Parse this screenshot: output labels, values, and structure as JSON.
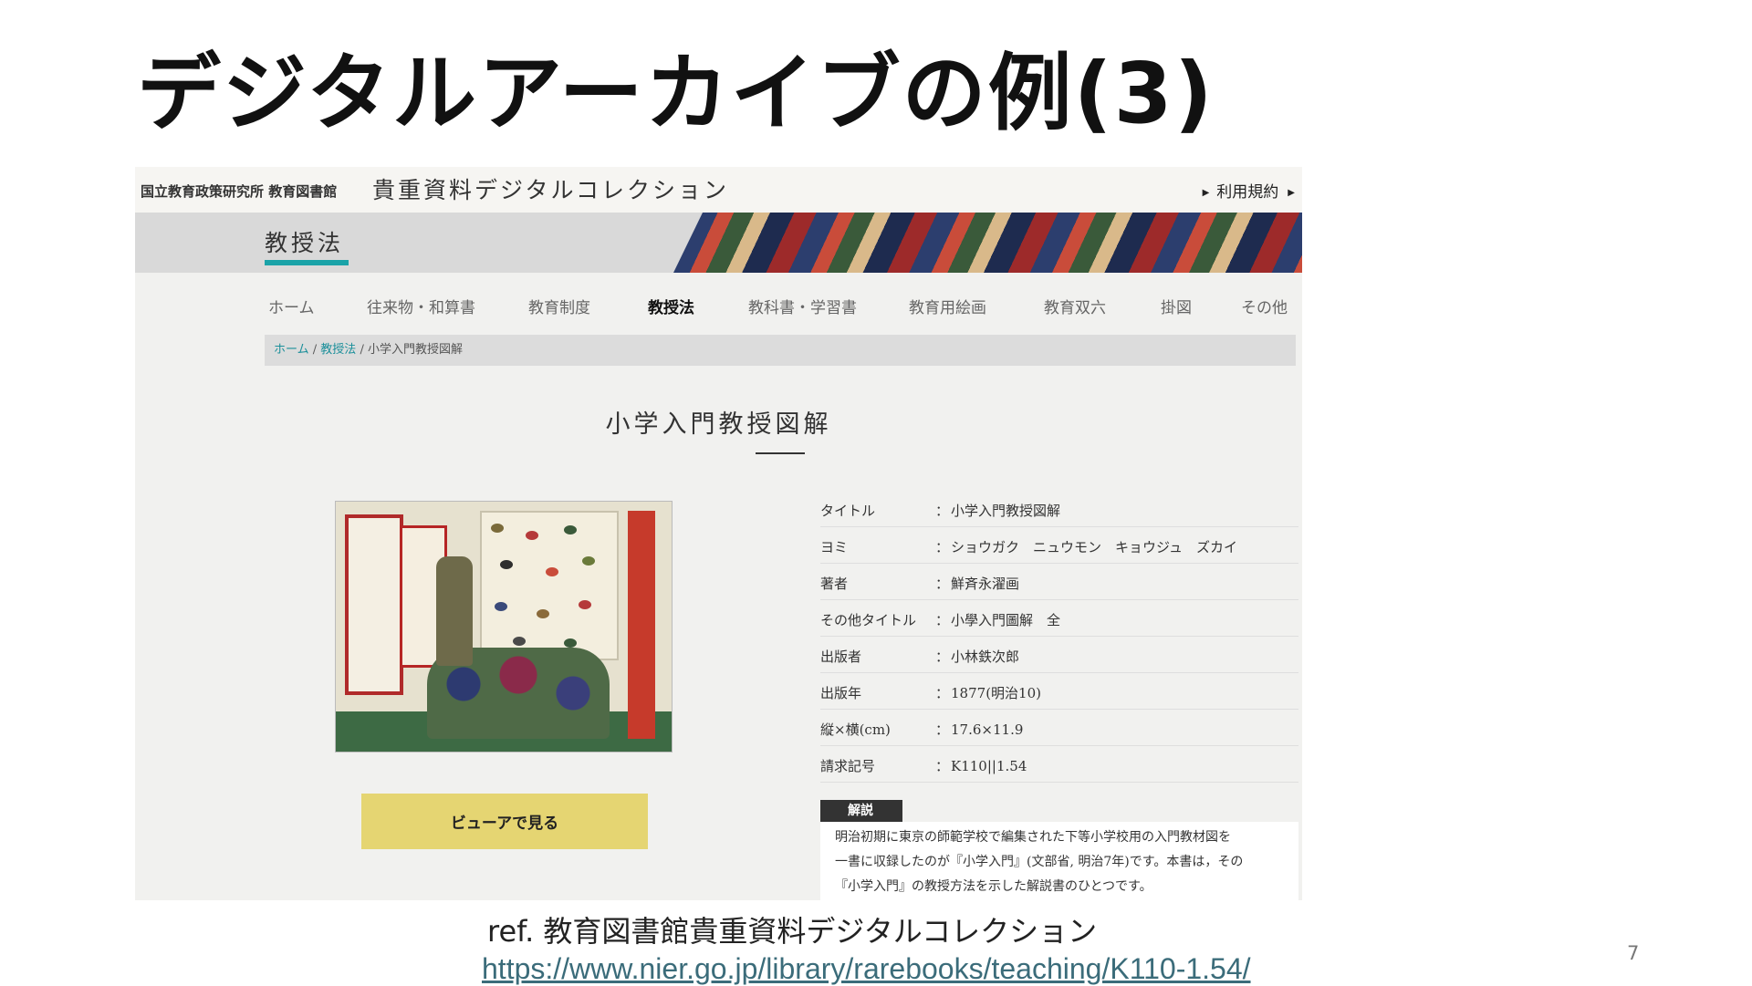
{
  "slide": {
    "title": "デジタルアーカイブの例(3)",
    "ref": "ref. 教育図書館貴重資料デジタルコレクション",
    "url": "https://www.nier.go.jp/library/rarebooks/teaching/K110-1.54/",
    "page_number": "7"
  },
  "site": {
    "org": "国立教育政策研究所 教育図書館",
    "title": "貴重資料デジタルコレクション",
    "terms_link": "利用規約",
    "section_label": "教授法"
  },
  "nav": {
    "items": [
      {
        "label": "ホーム"
      },
      {
        "label": "往来物・和算書"
      },
      {
        "label": "教育制度"
      },
      {
        "label": "教授法",
        "active": true
      },
      {
        "label": "教科書・学習書"
      },
      {
        "label": "教育用絵画"
      },
      {
        "label": "教育双六"
      },
      {
        "label": "掛図"
      },
      {
        "label": "その他"
      }
    ]
  },
  "breadcrumb": {
    "home": "ホーム",
    "section": "教授法",
    "current": "小学入門教授図解",
    "separator": "/"
  },
  "item": {
    "title": "小学入門教授図解",
    "metadata": [
      {
        "key": "タイトル",
        "value": "小学入門教授図解"
      },
      {
        "key": "ヨミ",
        "value": "ショウガク　ニュウモン　キョウジュ　ズカイ"
      },
      {
        "key": "著者",
        "value": "鮮斉永濯画"
      },
      {
        "key": "その他タイトル",
        "value": "小學入門圖解　全"
      },
      {
        "key": "出版者",
        "value": "小林鉄次郎"
      },
      {
        "key": "出版年",
        "value": "1877(明治10)"
      },
      {
        "key": "縦×横(cm)",
        "value": "17.6×11.9"
      },
      {
        "key": "請求記号",
        "value": "K110||1.54"
      }
    ],
    "viewer_button": "ビューアで見る",
    "description_label": "解説",
    "description_lines": [
      "明治初期に東京の師範学校で編集された下等小学校用の入門教材図を",
      "一書に収録したのが『小学入門』(文部省, 明治7年)です。本書は，その",
      "『小学入門』の教授方法を示した解説書のひとつです。"
    ]
  },
  "colors": {
    "accent_teal": "#1aa3a8",
    "viewer_button": "#e5d572",
    "link": "#3b6c7a"
  }
}
